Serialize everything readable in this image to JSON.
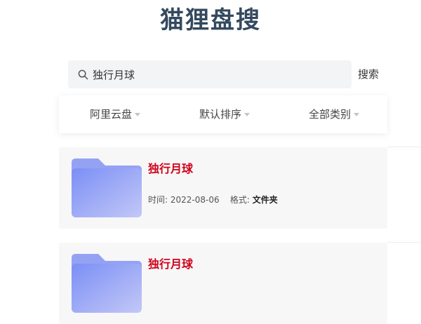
{
  "site_title": "猫狸盘搜",
  "search": {
    "value": "独行月球",
    "button_label": "搜索"
  },
  "filters": [
    {
      "label": "阿里云盘"
    },
    {
      "label": "默认排序"
    },
    {
      "label": "全部类别"
    }
  ],
  "results": [
    {
      "title": "独行月球",
      "time_label": "时间:",
      "time_value": "2022-08-06",
      "format_label": "格式:",
      "format_value": "文件夹",
      "icon": "folder-icon"
    },
    {
      "title": "独行月球",
      "icon": "folder-icon"
    }
  ],
  "colors": {
    "title": "#34495e",
    "result_title": "#d0021b",
    "search_bg": "#f3f4f6",
    "card_bg": "#f7f7f7",
    "folder_gradient_start": "#7b8ff5",
    "folder_gradient_end": "#c3c8f7"
  }
}
